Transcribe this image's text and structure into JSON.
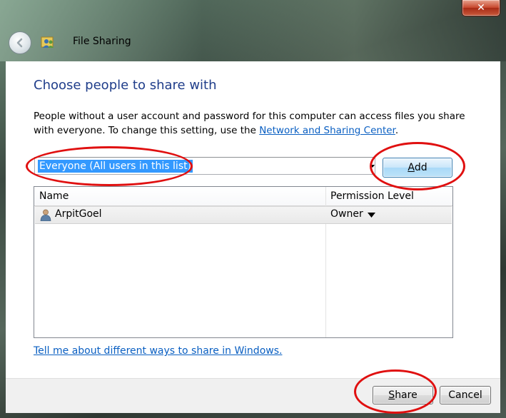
{
  "window": {
    "title": "File Sharing",
    "close_glyph": "✕",
    "back_icon": "back-arrow-icon",
    "app_icon": "file-sharing-users-icon"
  },
  "dialog": {
    "heading": "Choose people to share with",
    "description_pre": "People without a user account and password for this computer can access files you share with everyone.  To change this setting, use the ",
    "description_link": "Network and Sharing Center",
    "description_post": ".",
    "combo": {
      "value": "Everyone (All users in this list)"
    },
    "add_button": {
      "accel": "A",
      "rest": "dd"
    },
    "list": {
      "columns": [
        "Name",
        "Permission Level"
      ],
      "rows": [
        {
          "name": "ArpitGoel",
          "permission": "Owner",
          "icon": "user-icon"
        }
      ]
    },
    "help_link": "Tell me about different ways to share in Windows."
  },
  "footer": {
    "share_button": {
      "accel": "S",
      "rest": "hare"
    },
    "cancel_button": "Cancel"
  },
  "colors": {
    "heading": "#1f3d8a",
    "link": "#0a5fc2",
    "selection": "#3399ff",
    "annotation": "#e01010"
  }
}
